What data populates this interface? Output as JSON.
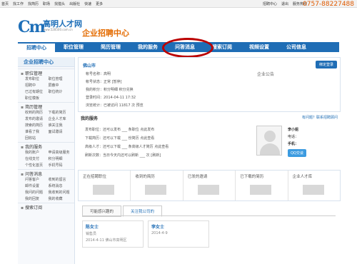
{
  "topbar": {
    "nav": [
      "首页",
      "找工作",
      "找简历",
      "职场",
      "找猎头",
      "出版社",
      "快速",
      "更多"
    ],
    "right": [
      "招聘中心",
      "退出",
      "服务热线"
    ],
    "hotline": "0757-88227488"
  },
  "header": {
    "logo_letters": "Cm",
    "site_name": "高明人才网",
    "site_url": "www.528500.com.cn",
    "center_title": "企业招聘中心"
  },
  "mainnav": {
    "items": [
      "招聘中心",
      "职位管理",
      "简历管理",
      "我的服务",
      "问答消息",
      "搜索订阅",
      "视频设置",
      "公司信息"
    ],
    "active": 0
  },
  "sidebar": {
    "title": "企业招聘中心",
    "sections": [
      {
        "title": "职位管理",
        "items": [
          "发布职位",
          "职位管理",
          "招聘中",
          "屏蔽中",
          "已过有期位",
          "职位统计",
          "职位模板"
        ]
      },
      {
        "title": "简历管理",
        "items": [
          "收到的简历",
          "下载的简历",
          "发布的邀请",
          "企业人才库",
          "搜索的简历",
          "谁关注我",
          "谁看了我",
          "面试邀请",
          "回收站"
        ]
      },
      {
        "title": "我的服务",
        "items": [
          "我的账户",
          "申请高级服务",
          "在线支付",
          "积分明细",
          "个性化首页",
          "手机号码"
        ]
      },
      {
        "title": "问答消息",
        "items": [
          "问答客户",
          "收到的留言",
          "邮件设置",
          "系统消息",
          "我问的问题",
          "我收到的问题",
          "我的回复",
          "我的收藏"
        ]
      },
      {
        "title": "搜索订阅",
        "items": []
      }
    ]
  },
  "info": {
    "city": "佛山市",
    "login_btn": "绑定登录",
    "rows": [
      "帐号名称：高明",
      "帐号状态：正常 [暂停]",
      "我的积分：积分明细 积分兑换",
      "登录时间：2014-04-11 17:32",
      "浏览统计：已被访问 11817 次 预览"
    ],
    "notice_title": "企业公告"
  },
  "service": {
    "title": "我的服务",
    "link": "有问题？联系招聘顾问",
    "rows": [
      "发布职位：还可以发布 ___ 条职位 点此发布",
      "下载简历：还可以下载 ___ 份简历 点此查看",
      "高级人才：还可以下载 ___ 条高级人才简历 点此查看",
      "刷新次数：当日今天内还可以刷新 ___ 次 [刷新]"
    ]
  },
  "contact": {
    "name": "李小姐",
    "phone_label": "电话：",
    "mobile_label": "手机：",
    "qq_btn": "QQ交谈"
  },
  "stats": [
    "正在招聘职位",
    "收到的简历",
    "已发的邀请",
    "已下载的简历",
    "企业人才库"
  ],
  "tabs": [
    "可能感兴趣的",
    "关注我公司的"
  ],
  "active_tab": 1,
  "cards": [
    {
      "name": "陈女士",
      "job": "销售员",
      "meta": "2014-4-11  佛山市高明区"
    },
    {
      "name": "李女士",
      "job": "",
      "meta": "2014-4-9"
    }
  ]
}
